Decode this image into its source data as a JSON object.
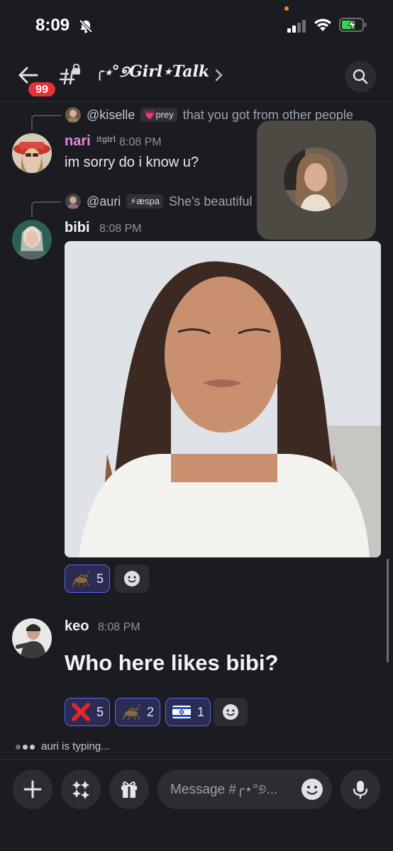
{
  "status_bar": {
    "time": "8:09"
  },
  "header": {
    "unread_badge": "99",
    "channel_name": "╭⋆°୭Girl⋆Talk"
  },
  "messages": [
    {
      "reply": {
        "user": "@kiselle",
        "role": "💗prey",
        "text": "that you got from other people"
      },
      "author": "nari",
      "author_tag": "itgirl",
      "time": "8:08 PM",
      "text": "im sorry do i know u?"
    },
    {
      "reply": {
        "user": "@auri",
        "role": "⚡æspa",
        "text": "She's beautiful"
      },
      "author": "bibi",
      "time": "8:08 PM",
      "reactions": [
        {
          "emoji": "cricket",
          "count": "5"
        }
      ]
    },
    {
      "author": "keo",
      "time": "8:08 PM",
      "text": "Who here likes bibi?",
      "reactions": [
        {
          "emoji": "cross-mark",
          "count": "5"
        },
        {
          "emoji": "cricket",
          "count": "2"
        },
        {
          "emoji": "flag-israel",
          "count": "1"
        }
      ]
    }
  ],
  "typing": "auri is typing...",
  "composer": {
    "placeholder": "Message #╭⋆°୭..."
  },
  "colors": {
    "accent": "#5865f2",
    "badge": "#e3323c",
    "nari_name": "#e58ad9",
    "background": "#1b1c21"
  }
}
